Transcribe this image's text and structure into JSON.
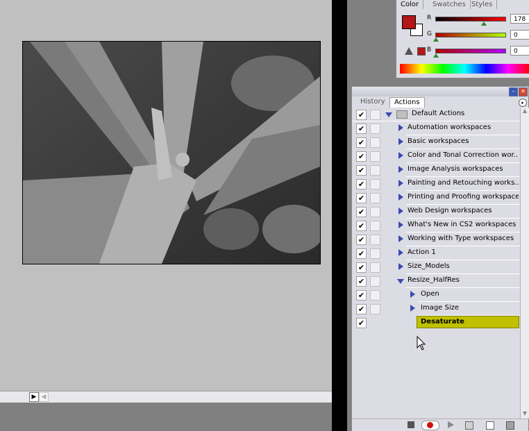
{
  "color_panel": {
    "tabs": [
      "Color",
      "Swatches",
      "Styles"
    ],
    "channels": [
      {
        "label": "R",
        "value": "178"
      },
      {
        "label": "G",
        "value": "0"
      },
      {
        "label": "B",
        "value": "0"
      }
    ],
    "foreground_color": "#b21616",
    "background_color": "#ffffff"
  },
  "actions_panel": {
    "tabs": [
      "History",
      "Actions"
    ],
    "rows": [
      {
        "label": "Default Actions"
      },
      {
        "label": "Automation workspaces"
      },
      {
        "label": "Basic workspaces"
      },
      {
        "label": "Color and Tonal Correction wor..."
      },
      {
        "label": "Image Analysis workspaces"
      },
      {
        "label": "Painting and Retouching works..."
      },
      {
        "label": "Printing and Proofing workspaces"
      },
      {
        "label": "Web Design workspaces"
      },
      {
        "label": "What's New in CS2 workspaces"
      },
      {
        "label": "Working with Type workspaces"
      },
      {
        "label": "Action 1"
      },
      {
        "label": "Size_Models"
      },
      {
        "label": "Resize_HalfRes"
      },
      {
        "label": "Open"
      },
      {
        "label": "Image Size"
      },
      {
        "label": "Desaturate"
      }
    ],
    "highlight_color": "#c0c000"
  },
  "icons": {
    "fold": "triangle-right-icon",
    "unfold": "triangle-down-icon",
    "folder": "folder-icon",
    "check": "checkmark-icon",
    "stop": "stop-icon",
    "record": "record-icon",
    "play": "play-icon",
    "new_set": "folder-icon",
    "new_action": "new-icon",
    "trash": "trash-icon",
    "warning": "warning-icon"
  }
}
